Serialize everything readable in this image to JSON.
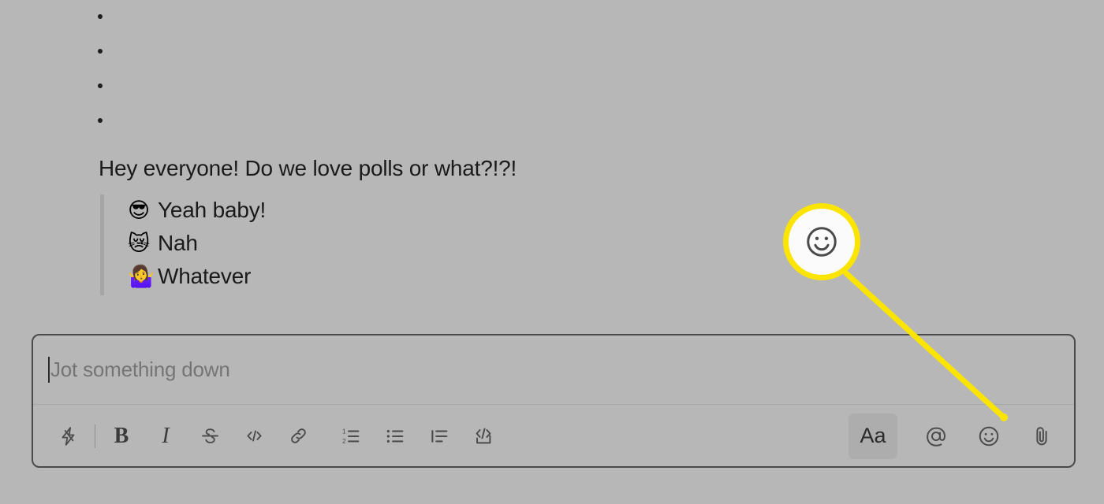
{
  "app": {
    "background_color": "#b7b7b7",
    "accent_color": "#fbe500",
    "text_color": "#1a1a1a"
  },
  "message": {
    "typing_dots_count": 4,
    "body": "Hey everyone! Do we love polls or what?!?!",
    "poll_options": [
      {
        "emoji": "😎",
        "emoji_name": "smiling-face-with-sunglasses",
        "label": "Yeah baby!"
      },
      {
        "emoji": "😿",
        "emoji_name": "crying-cat-face",
        "label": "Nah"
      },
      {
        "emoji": "🤷‍♀️",
        "emoji_name": "woman-shrugging",
        "label": "Whatever"
      }
    ]
  },
  "composer": {
    "placeholder": "Jot something down",
    "value": "",
    "toolbar_left": [
      {
        "name": "shortcuts-lightning-icon",
        "label": "Shortcuts"
      },
      {
        "name": "bold-button",
        "label": "B"
      },
      {
        "name": "italic-button",
        "label": "I"
      },
      {
        "name": "strikethrough-button",
        "label": "S"
      },
      {
        "name": "code-button",
        "label": "</>"
      },
      {
        "name": "link-button",
        "label": "Link"
      },
      {
        "name": "ordered-list-button",
        "label": "Ordered list"
      },
      {
        "name": "bulleted-list-button",
        "label": "Bulleted list"
      },
      {
        "name": "blockquote-button",
        "label": "Blockquote"
      },
      {
        "name": "code-block-button",
        "label": "Code block"
      }
    ],
    "toolbar_right": [
      {
        "name": "formatting-toggle-button",
        "label": "Aa",
        "selected": true
      },
      {
        "name": "mention-button",
        "label": "@"
      },
      {
        "name": "emoji-button",
        "label": "Emoji"
      },
      {
        "name": "attachment-button",
        "label": "Attach"
      }
    ]
  },
  "callout": {
    "target": "emoji-button",
    "icon_name": "smiley-face-icon",
    "ring_color": "#fbe500",
    "fill_color": "#fbfbfb"
  }
}
